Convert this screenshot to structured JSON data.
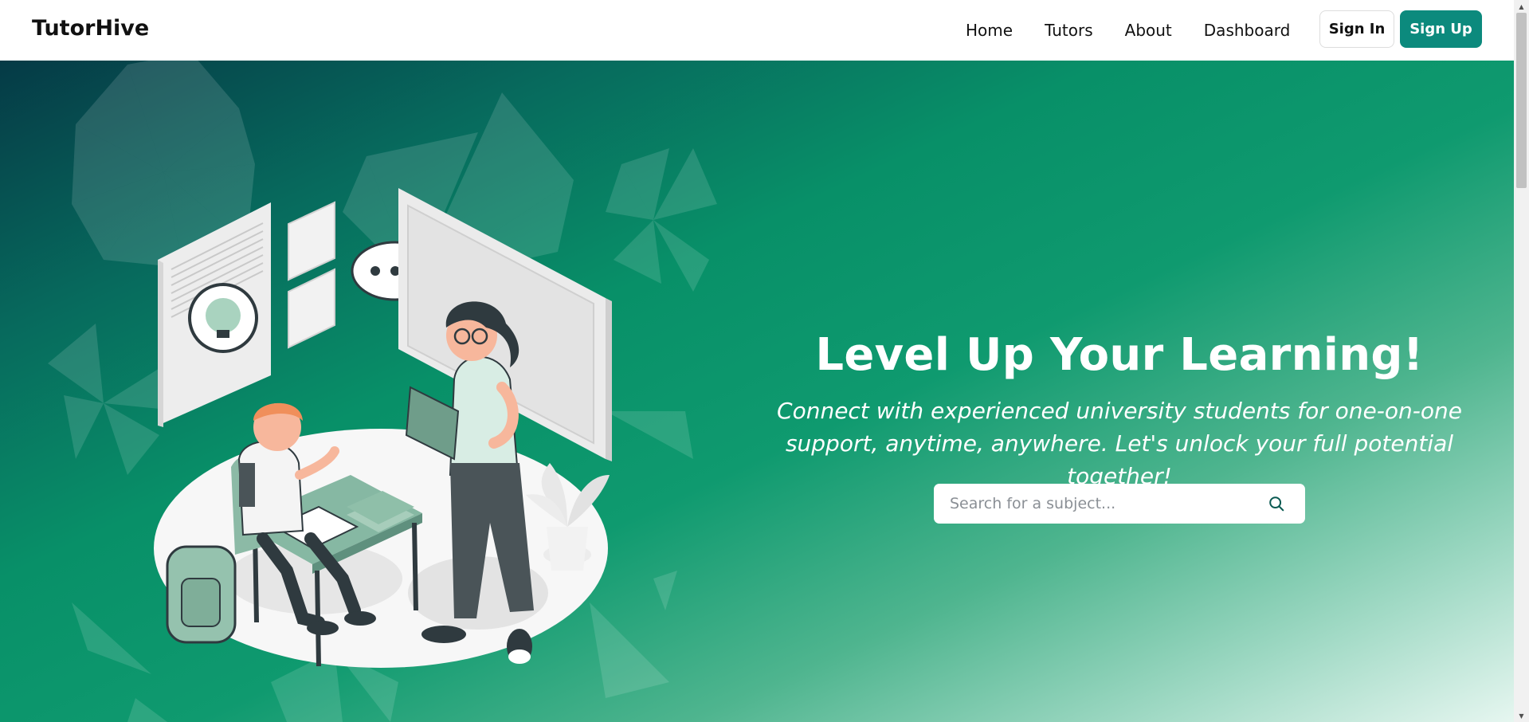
{
  "header": {
    "brand": "TutorHive",
    "nav": [
      "Home",
      "Tutors",
      "About",
      "Dashboard"
    ],
    "sign_in": "Sign In",
    "sign_up": "Sign Up"
  },
  "hero": {
    "title": "Level Up Your Learning!",
    "subtitle": "Connect with experienced university students for one-on-one support, anytime, anywhere. Let's unlock your full potential together!",
    "search": {
      "placeholder": "Search for a subject...",
      "value": ""
    }
  },
  "colors": {
    "accent": "#0c8a7d",
    "hero_gradient": [
      "#053a46",
      "#089068",
      "#e6f6f0"
    ]
  },
  "icons": {
    "search": "search-icon",
    "illustration": "tutoring-illustration"
  }
}
